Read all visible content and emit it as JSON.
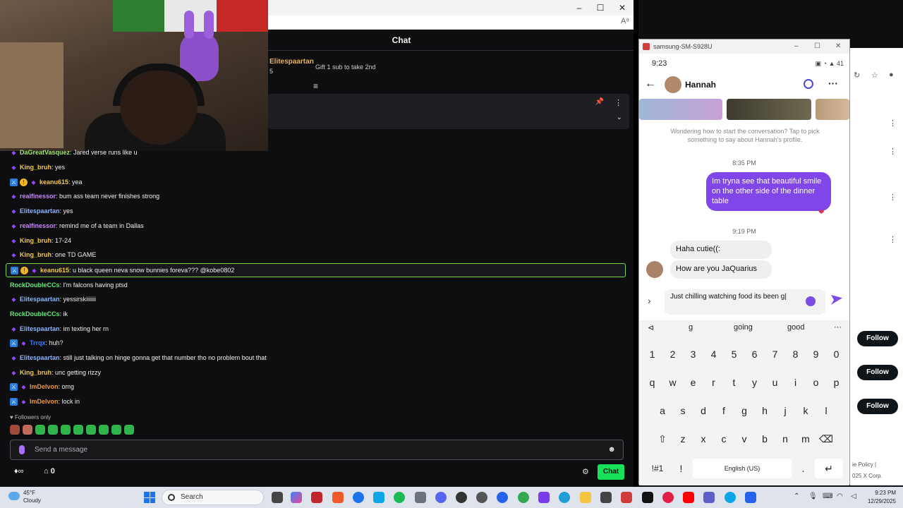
{
  "browser": {
    "controls": [
      "–",
      "☐",
      "✕"
    ],
    "reader_icon": "A⁸"
  },
  "chat": {
    "header": "Chat",
    "gift": {
      "name": "Elitespaartan",
      "count": "5",
      "text": "Gift 1 sub to take 2nd"
    },
    "messages": [
      {
        "badges": [
          "prime"
        ],
        "user": "DaGreatVasquez",
        "color": "#a3e86a",
        "text": ": Jared verse runs like u"
      },
      {
        "badges": [
          "prime"
        ],
        "user": "King_bruh",
        "color": "#f2c94c",
        "text": ": yes"
      },
      {
        "badges": [
          "mod",
          "coin",
          "prime"
        ],
        "user": "keanu615",
        "color": "#f2c94c",
        "text": ": yea"
      },
      {
        "badges": [
          "prime"
        ],
        "user": "realfinessor",
        "color": "#c58af9",
        "text": ": bum ass team never finishes strong"
      },
      {
        "badges": [
          "prime"
        ],
        "user": "Elitespaartan",
        "color": "#8ab4f8",
        "text": ": yes"
      },
      {
        "badges": [
          "prime"
        ],
        "user": "realfinessor",
        "color": "#c58af9",
        "text": ": remind me of a team in Dallas"
      },
      {
        "badges": [
          "prime"
        ],
        "user": "King_bruh",
        "color": "#f2c94c",
        "text": ": 17-24"
      },
      {
        "badges": [
          "prime"
        ],
        "user": "King_bruh",
        "color": "#f2c94c",
        "text": ": one TD GAME"
      },
      {
        "badges": [
          "mod",
          "coin",
          "prime"
        ],
        "user": "keanu615",
        "color": "#f2c94c",
        "text": ": u black queen neva snow bunnies foreva??? @kobe0802",
        "highlight": true
      },
      {
        "badges": [],
        "user": "RockDoubleCCs",
        "color": "#5ee87a",
        "text": ": I'm falcons having ptsd"
      },
      {
        "badges": [
          "prime"
        ],
        "user": "Elitespaartan",
        "color": "#8ab4f8",
        "text": ": yessirskiiiiiii"
      },
      {
        "badges": [],
        "user": "RockDoubleCCs",
        "color": "#5ee87a",
        "text": ": ik"
      },
      {
        "badges": [
          "prime"
        ],
        "user": "Elitespaartan",
        "color": "#8ab4f8",
        "text": ": im texting her rn"
      },
      {
        "badges": [
          "mod",
          "prime"
        ],
        "user": "Trrqx",
        "color": "#3d7dfc",
        "text": ": huh?"
      },
      {
        "badges": [
          "prime"
        ],
        "user": "Elitespaartan",
        "color": "#8ab4f8",
        "text": ": still just talking on hinge gonna get that number tho no problem bout that"
      },
      {
        "badges": [
          "prime"
        ],
        "user": "King_bruh",
        "color": "#f2c94c",
        "text": ": unc getting rizzy"
      },
      {
        "badges": [
          "mod",
          "prime"
        ],
        "user": "ImDelvon",
        "color": "#f0963a",
        "text": ": omg"
      },
      {
        "badges": [
          "mod",
          "prime"
        ],
        "user": "ImDelvon",
        "color": "#f0963a",
        "text": ": lock in"
      }
    ],
    "followers_only": "♥ Followers only",
    "send_placeholder": "Send a message",
    "bottom_left": "♦∞",
    "points": "0",
    "chat_button": "Chat"
  },
  "phone": {
    "window_title": "samsung-SM-S928U",
    "time": "9:23",
    "status_icons": "▣ ◔ ▲ 41",
    "contact": "Hannah",
    "hint": "Wondering how to start the conversation? Tap to pick something to say about Hannah's profile.",
    "time1": "8:35 PM",
    "my_message": "Im tryna see that beautiful smile on the other side of the dinner table",
    "time2": "9:19 PM",
    "their_msg1": "Haha cutie((:",
    "their_msg2": "How are you JaQuarius",
    "draft": "Just chilling watching food its been g|",
    "suggestions": [
      "g",
      "going",
      "good"
    ],
    "keys_num": [
      "1",
      "2",
      "3",
      "4",
      "5",
      "6",
      "7",
      "8",
      "9",
      "0"
    ],
    "keys_r1": [
      "q",
      "w",
      "e",
      "r",
      "t",
      "y",
      "u",
      "i",
      "o",
      "p"
    ],
    "keys_r2": [
      "a",
      "s",
      "d",
      "f",
      "g",
      "h",
      "j",
      "k",
      "l"
    ],
    "keys_r3": [
      "z",
      "x",
      "c",
      "v",
      "b",
      "n",
      "m"
    ],
    "sym_key": "!#1",
    "excl_key": "!",
    "space_label": "English (US)",
    "period_key": "."
  },
  "right_panel": {
    "follow_label": "Follow",
    "policy": "ie Policy  |",
    "xcorp": "025 X Corp."
  },
  "taskbar": {
    "temp": "45°F",
    "weather": "Cloudy",
    "search": "Search",
    "time": "9:23 PM",
    "date": "12/29/2025"
  }
}
